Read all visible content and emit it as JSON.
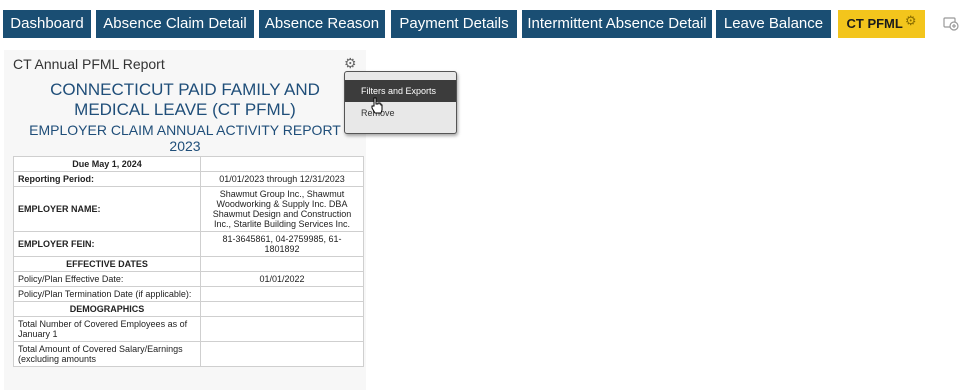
{
  "tabs": [
    {
      "label": "Dashboard"
    },
    {
      "label": "Absence Claim Detail"
    },
    {
      "label": "Absence Reason"
    },
    {
      "label": "Payment Details"
    },
    {
      "label": "Intermittent Absence Detail"
    },
    {
      "label": "Leave Balance"
    },
    {
      "label": "CT PFML",
      "active": true
    }
  ],
  "card": {
    "title": "CT Annual PFML Report",
    "heading1_line1": "CONNECTICUT PAID FAMILY AND",
    "heading1_line2": "MEDICAL LEAVE (CT PFML)",
    "heading2_line1": "EMPLOYER CLAIM ANNUAL ACTIVITY REPORT",
    "heading2_line2": "2023"
  },
  "report": {
    "due": "Due May 1, 2024",
    "reporting_period_label": "Reporting Period:",
    "reporting_period_value": "01/01/2023 through 12/31/2023",
    "employer_name_label": "EMPLOYER NAME:",
    "employer_name_value": "Shawmut Group Inc., Shawmut Woodworking & Supply Inc. DBA Shawmut Design and Construction Inc., Starlite Building Services Inc.",
    "employer_fein_label": "EMPLOYER FEIN:",
    "employer_fein_value": "81-3645861, 04-2759985, 61-1801892",
    "effective_dates_header": "EFFECTIVE DATES",
    "policy_effective_label": "Policy/Plan Effective Date:",
    "policy_effective_value": "01/01/2022",
    "policy_termination_label": "Policy/Plan Termination Date (if applicable):",
    "demographics_header": "DEMOGRAPHICS",
    "covered_employees_label": "Total Number of Covered Employees as of January 1",
    "covered_salary_label": "Total Amount of Covered Salary/Earnings (excluding amounts"
  },
  "menu": {
    "items": [
      {
        "label": "Filters and Exports"
      },
      {
        "label": "Remove"
      }
    ]
  },
  "colors": {
    "tab_bg": "#1a4e73",
    "tab_active_bg": "#f3c51c",
    "heading": "#1f4e79"
  },
  "icons": [
    "gear-icon",
    "add-tab-icon",
    "cursor-icon"
  ]
}
